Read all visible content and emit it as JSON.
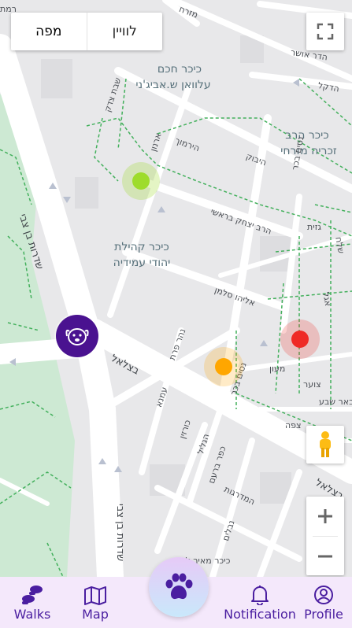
{
  "map": {
    "type_toggle": {
      "map_label": "מפה",
      "satellite_label": "לוויין",
      "active": "map"
    },
    "labels": {
      "square_hacham": "כיכר חכם",
      "square_hacham_2": "עלוואן ש.אביג'ני",
      "square_harav": "כיכר הרב",
      "square_harav_2": "זכריה מזרחי",
      "square_kehilat": "כיכר קהילת",
      "square_kehilat_2": "יהודי עמידיה",
      "sderot_ben_zvi": "שדרות בן צבי",
      "sderot_ben_zvi_2": "שדרות בן צבי",
      "betzalel": "בצלאל",
      "betzalel_2": "בצלאל",
      "harav_yitzhak": "הרב יצחק בראשי",
      "eliyahu_salman": "אליהו סלמן",
      "nisim_bekhar": "נסים בכר",
      "nisim_bekhar_2": "נסים בכר",
      "neheh_prat": "נהר פרת",
      "hadekel": "הדקל",
      "hirmuk": "הירמוך",
      "hiboq": "היבוק",
      "arnon": "ארנון",
      "hadar": "הדר אושר",
      "mizrah": "מזרח",
      "shevet_tzadik": "שבת צדק",
      "gazit": "גזית",
      "maon": "מעון",
      "tzoar": "צוער",
      "beer_sheva": "באר שבע",
      "tzfat": "צפה",
      "ramat": "רמת",
      "amnon": "עמנא",
      "kurazin": "כורזין",
      "hagalil": "הגליל",
      "kfar_baram": "כפר ברעם",
      "hamadrigot": "המדרגות",
      "nevalim": "נבלים",
      "kikar_meir": "כיכר מאיר לוי",
      "shimon": "שלח",
      "agal": "אגל"
    },
    "markers": [
      {
        "name": "green",
        "color": "#9edc2c"
      },
      {
        "name": "orange",
        "color": "#ffa600"
      },
      {
        "name": "red",
        "color": "#ef2a26"
      }
    ]
  },
  "nav": {
    "walks_label": "Walks",
    "map_label": "Map",
    "notification_label": "Notification",
    "profile_label": "Profile",
    "fab_icon": "paw-icon",
    "accent": "#4a1ea0"
  }
}
